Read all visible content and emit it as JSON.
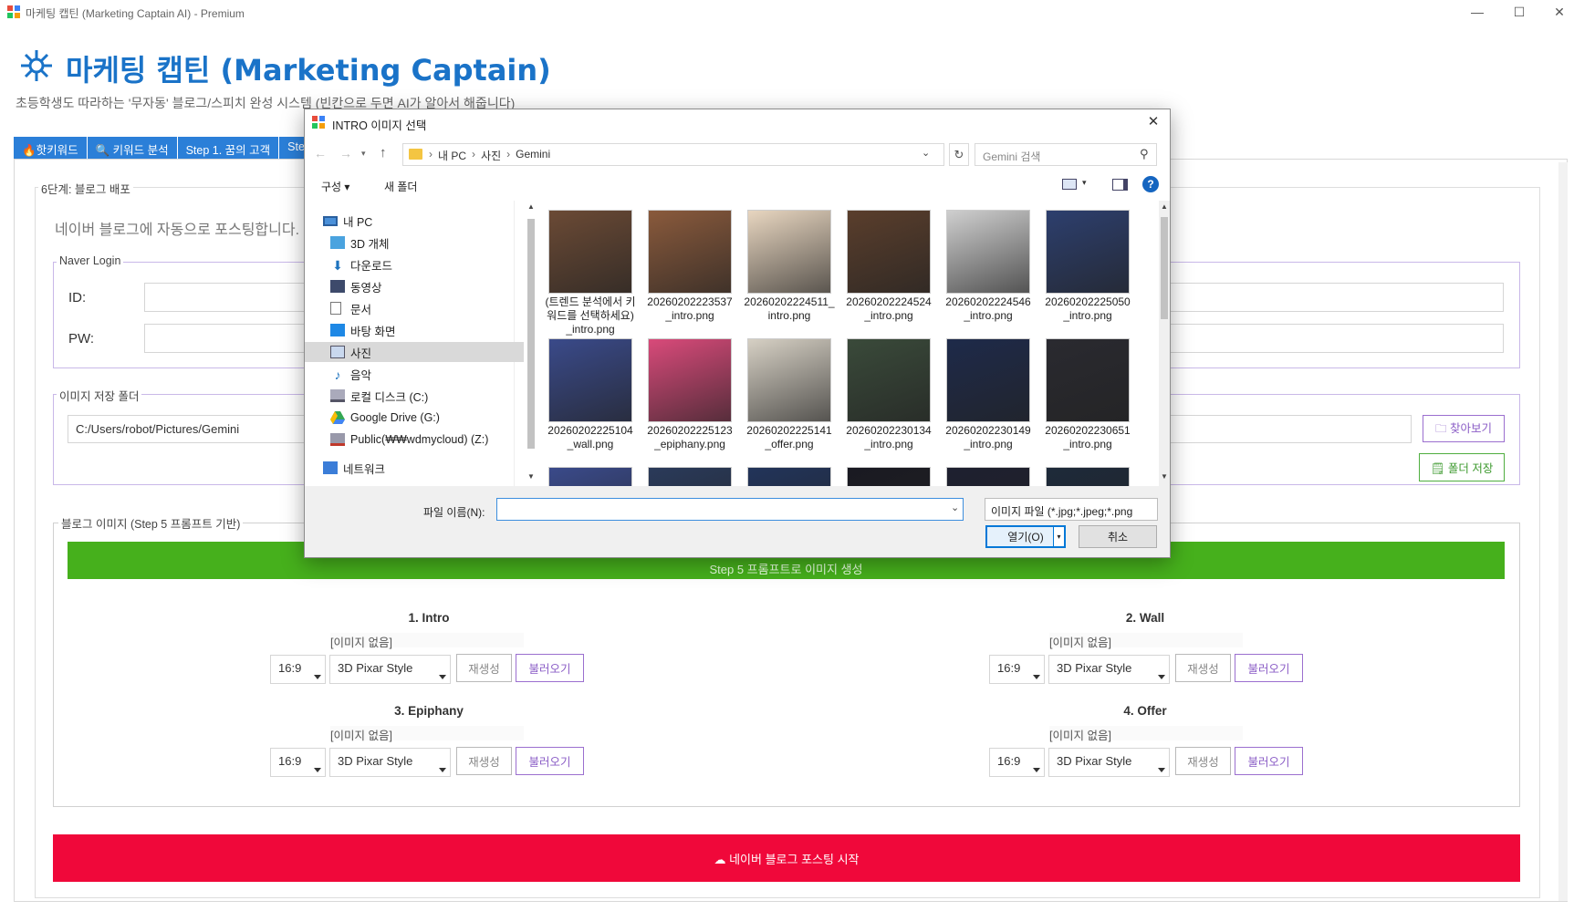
{
  "window": {
    "title": "마케팅 캡틴 (Marketing Captain AI) - Premium",
    "controls": [
      "—",
      "☐",
      "✕"
    ]
  },
  "header": {
    "title": "마케팅 캡틴 (Marketing Captain)",
    "subtitle": "초등학생도 따라하는 '무자동' 블로그/스피치 완성 시스템 (빈칸으로 두면 AI가 알아서 해줍니다)"
  },
  "tabs": [
    {
      "label": "🔥핫키워드"
    },
    {
      "label": "🔍 키워드 분석"
    },
    {
      "label": "Step 1. 꿈의 고객"
    },
    {
      "label": "Step"
    }
  ],
  "step6": {
    "group_title": "6단계: 블로그 배포",
    "description": "네이버 블로그에 자동으로 포스팅합니다.",
    "login": {
      "group_title": "Naver Login",
      "id_label": "ID:",
      "pw_label": "PW:"
    },
    "folder": {
      "group_title": "이미지 저장 폴더",
      "path": "C:/Users/robot/Pictures/Gemini",
      "browse_label": "🗀 찾아보기",
      "save_label": "🗒 폴더 저장"
    },
    "images": {
      "group_title": "블로그 이미지 (Step 5 프롬프트 기반)",
      "generate_label": "Step 5 프롬프트로 이미지 생성",
      "slots": [
        {
          "title": "1. Intro",
          "status": "[이미지 없음]",
          "ratio": "16:9",
          "style": "3D Pixar Style",
          "regen": "재생성",
          "load": "불러오기"
        },
        {
          "title": "2. Wall",
          "status": "[이미지 없음]",
          "ratio": "16:9",
          "style": "3D Pixar Style",
          "regen": "재생성",
          "load": "불러오기"
        },
        {
          "title": "3. Epiphany",
          "status": "[이미지 없음]",
          "ratio": "16:9",
          "style": "3D Pixar Style",
          "regen": "재생성",
          "load": "불러오기"
        },
        {
          "title": "4. Offer",
          "status": "[이미지 없음]",
          "ratio": "16:9",
          "style": "3D Pixar Style",
          "regen": "재생성",
          "load": "불러오기"
        }
      ]
    },
    "post_button": "☁ 네이버 블로그 포스팅 시작"
  },
  "dialog": {
    "title": "INTRO 이미지 선택",
    "breadcrumb": [
      "내 PC",
      "사진",
      "Gemini"
    ],
    "search_placeholder": "Gemini 검색",
    "organize": "구성 ▾",
    "new_folder": "새 폴더",
    "tree": [
      {
        "label": "내 PC",
        "icon": "pc-icon"
      },
      {
        "label": "3D 개체",
        "icon": "3d-objects-icon"
      },
      {
        "label": "다운로드",
        "icon": "download-icon"
      },
      {
        "label": "동영상",
        "icon": "video-icon"
      },
      {
        "label": "문서",
        "icon": "document-icon"
      },
      {
        "label": "바탕 화면",
        "icon": "desktop-icon"
      },
      {
        "label": "사진",
        "icon": "pictures-icon"
      },
      {
        "label": "음악",
        "icon": "music-icon"
      },
      {
        "label": "로컬 디스크 (C:)",
        "icon": "disk-icon"
      },
      {
        "label": "Google Drive (G:)",
        "icon": "google-drive-icon"
      },
      {
        "label": "Public(₩₩wdmycloud) (Z:)",
        "icon": "network-drive-icon"
      },
      {
        "label": "네트워크",
        "icon": "network-icon"
      }
    ],
    "files": [
      {
        "name": "(트렌드 분석에서 키워드를 선택하세요)_intro.png",
        "color": "#6b4a35"
      },
      {
        "name": "20260202223537_intro.png",
        "color": "#8a5a3c"
      },
      {
        "name": "20260202224511_intro.png",
        "color": "#e8d6c0"
      },
      {
        "name": "20260202224524_intro.png",
        "color": "#5a3e2c"
      },
      {
        "name": "20260202224546_intro.png",
        "color": "#cfcfcf"
      },
      {
        "name": "20260202225050_intro.png",
        "color": "#2d3f6e"
      },
      {
        "name": "20260202225104_wall.png",
        "color": "#3a4a8a"
      },
      {
        "name": "20260202225123_epiphany.png",
        "color": "#d94a7a"
      },
      {
        "name": "20260202225141_offer.png",
        "color": "#d6d0c4"
      },
      {
        "name": "20260202230134_intro.png",
        "color": "#3a4a3a"
      },
      {
        "name": "20260202230149_intro.png",
        "color": "#1e2a4a"
      },
      {
        "name": "20260202230651_intro.png",
        "color": "#2a2a30"
      },
      {
        "name": "",
        "color": "#3a4a8a"
      },
      {
        "name": "",
        "color": "#2a3a5a"
      },
      {
        "name": "",
        "color": "#22345a"
      },
      {
        "name": "",
        "color": "#1a1a22"
      },
      {
        "name": "",
        "color": "#1e2030"
      },
      {
        "name": "",
        "color": "#1e2a3a"
      }
    ],
    "filename_label": "파일 이름(N):",
    "filename_value": "",
    "filetype": "이미지 파일 (*.jpg;*.jpeg;*.png",
    "open_label": "열기(O)",
    "cancel_label": "취소"
  }
}
